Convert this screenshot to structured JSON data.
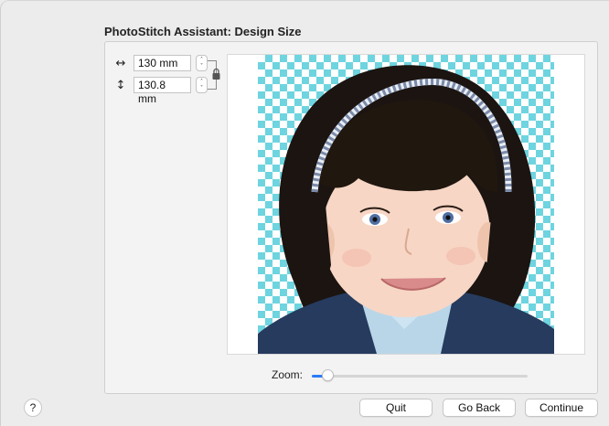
{
  "dialog": {
    "title": "PhotoStitch Assistant: Design Size"
  },
  "size": {
    "width_icon": "↔",
    "height_icon": "↕",
    "width_value": "130 mm",
    "height_value": "130.8 mm",
    "stepper_up": "˄",
    "stepper_down": "˅",
    "aspect_locked": true
  },
  "zoom": {
    "label": "Zoom:",
    "level": 0.05
  },
  "buttons": {
    "help": "?",
    "quit": "Quit",
    "back": "Go Back",
    "continue": "Continue"
  },
  "colors": {
    "transparency_checker": "#6ed4df",
    "accent": "#2a7cf6"
  }
}
